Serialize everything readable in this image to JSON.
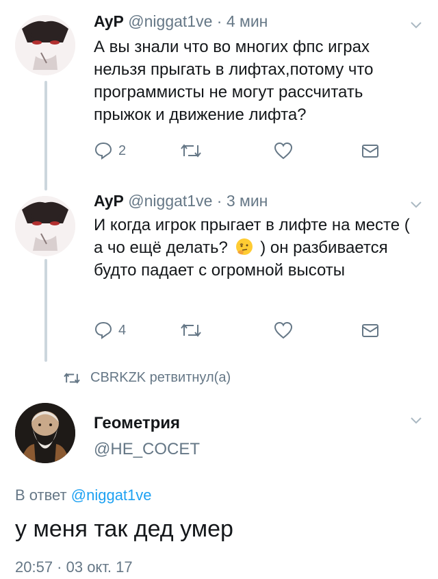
{
  "thread": [
    {
      "author_name": "AyP",
      "handle": "@niggat1ve",
      "separator": "·",
      "time": "4 мин",
      "text": "А вы знали что во многих фпс играх нельзя прыгать в лифтах,потому что программисты не могут рассчитать прыжок и движение лифта?",
      "reply_count": "2"
    },
    {
      "author_name": "AyP",
      "handle": "@niggat1ve",
      "separator": "·",
      "time": "3 мин",
      "text_before_emoji": "И когда игрок прыгает в лифте на месте ( а чо ещё делать?",
      "emoji": "thinking-face",
      "text_after_emoji": ") он разбивается будто падает с огромной высоты",
      "reply_count": "4"
    }
  ],
  "retweet_notice": "CBRKZK ретвитнул(а)",
  "main_tweet": {
    "author_name": "Геометрия",
    "handle": "@HE_COCET",
    "reply_prefix": "В ответ",
    "reply_mention": "@niggat1ve",
    "text": "у меня так дед умер",
    "timestamp": "20:57 · 03 окт. 17"
  },
  "colors": {
    "secondary_text": "#657786",
    "link": "#1da1f2",
    "thread_line": "#ccd6dd"
  },
  "icons": [
    "chevron-down-icon",
    "reply-icon",
    "retweet-icon",
    "like-icon",
    "dm-icon"
  ]
}
